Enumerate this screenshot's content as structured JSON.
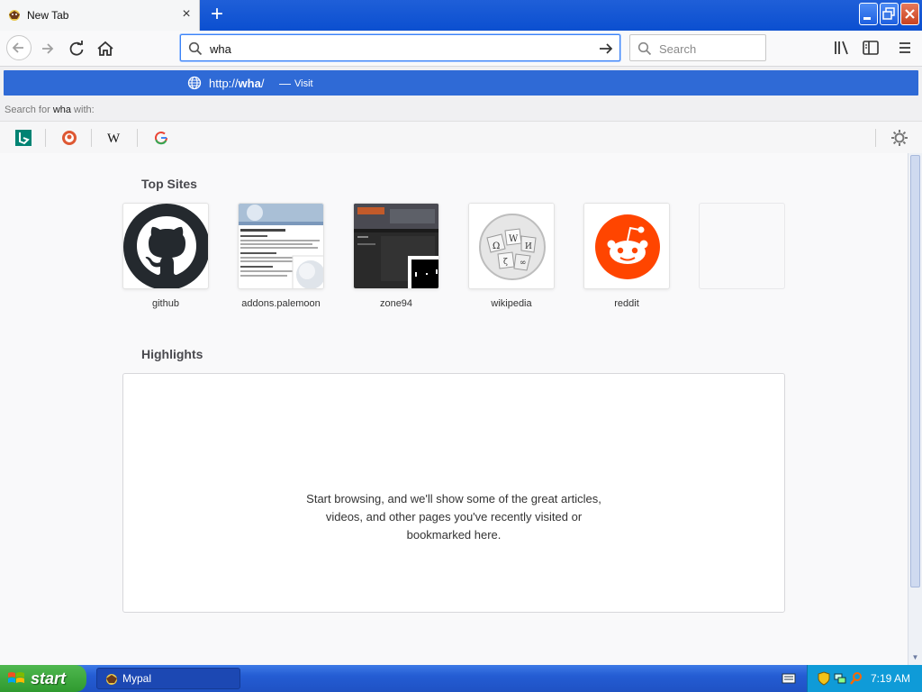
{
  "window": {
    "tab_title": "New Tab",
    "tab_favicon": "moon-browser-icon",
    "new_tab": "+",
    "buttons": {
      "minimize": "minimize-icon",
      "maximize": "maximize-icon",
      "close": "close-icon"
    }
  },
  "toolbar": {
    "url_value": "wha",
    "search_placeholder": "Search",
    "icons": [
      "back-icon",
      "forward-icon",
      "reload-icon",
      "home-icon",
      "go-arrow-icon",
      "library-icon",
      "sidebar-icon",
      "menu-icon"
    ]
  },
  "autocomplete": {
    "result_prefix": "http://",
    "result_term": "wha",
    "result_suffix": "/",
    "result_sep": "—",
    "result_action": "Visit",
    "search_for_prefix": "Search for ",
    "search_for_term": "wha",
    "search_for_suffix": " with:",
    "engines": [
      "Bing",
      "DuckDuckGo",
      "Wikipedia",
      "Google"
    ]
  },
  "page": {
    "top_sites_title": "Top Sites",
    "highlights_title": "Highlights",
    "top_sites": [
      {
        "label": "github"
      },
      {
        "label": "addons.palemoon"
      },
      {
        "label": "zone94"
      },
      {
        "label": "wikipedia"
      },
      {
        "label": "reddit"
      },
      {
        "label": ""
      }
    ],
    "highlights_message_1": "Start browsing, and we'll show some of the great articles,",
    "highlights_message_2": "videos, and other pages you've recently visited or",
    "highlights_message_3": "bookmarked here."
  },
  "taskbar": {
    "start_label": "start",
    "task_item": "Mypal",
    "clock": "7:19 AM"
  },
  "colors": {
    "accent": "#2f6ad6",
    "titlebar": "#0b4fd0",
    "reddit": "#ff4500",
    "github": "#24292e",
    "taskbar": "#245cd3",
    "start": "#2f9a2f"
  }
}
